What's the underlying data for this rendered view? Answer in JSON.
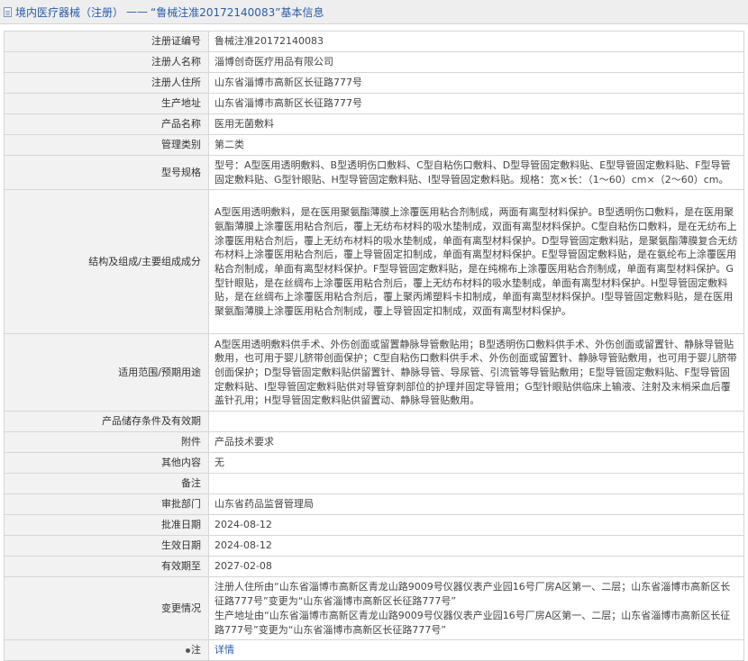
{
  "breadcrumb": {
    "section": "境内医疗器械（注册）",
    "separator": "——",
    "record_title": "“鲁械注准20172140083”",
    "suffix": "基本信息"
  },
  "fields": [
    {
      "key": "reg_no",
      "label": "注册证编号",
      "value": "鲁械注准20172140083"
    },
    {
      "key": "registrant",
      "label": "注册人名称",
      "value": "淄博创奇医疗用品有限公司"
    },
    {
      "key": "registrant_address",
      "label": "注册人住所",
      "value": "山东省淄博市高新区长征路777号"
    },
    {
      "key": "production_address",
      "label": "生产地址",
      "value": "山东省淄博市高新区长征路777号"
    },
    {
      "key": "product_name",
      "label": "产品名称",
      "value": "医用无菌敷料"
    },
    {
      "key": "management_class",
      "label": "管理类别",
      "value": "第二类"
    },
    {
      "key": "models",
      "label": "型号规格",
      "value": "型号：A型医用透明敷料、B型透明伤口敷料、C型自粘伤口敷料、D型导管固定敷料贴、E型导管固定敷料贴、F型导管固定敷料贴、G型针眼贴、H型导管固定敷料贴、I型导管固定敷料贴。规格：宽×长：（1～60）cm×（2～60）cm。"
    },
    {
      "key": "composition",
      "label": "结构及组成/主要组成成分",
      "value": "A型医用透明敷料，是在医用聚氨酯薄膜上涂覆医用粘合剂制成，两面有离型材料保护。B型透明伤口敷料，是在医用聚氨酯薄膜上涂覆医用粘合剂后，覆上无纺布材料的吸水垫制成，双面有离型材料保护。C型自粘伤口敷料，是在无纺布上涂覆医用粘合剂后，覆上无纺布材料的吸水垫制成，单面有离型材料保护。D型导管固定敷料贴，是聚氨酯薄膜复合无纺布材料上涂覆医用粘合剂后，覆上导管固定扣制成，单面有离型材料保护。E型导管固定敷料贴，是在氨纶布上涂覆医用粘合剂制成，单面有离型材料保护。F型导管固定敷料贴，是在纯棉布上涂覆医用粘合剂制成，单面有离型材料保护。G型针眼贴，是在丝绸布上涂覆医用粘合剂后，覆上无纺布材料的吸水垫制成，单面有离型材料保护。H型导管固定敷料贴，是在丝绸布上涂覆医用粘合剂后，覆上聚丙烯塑料卡扣制成，单面有离型材料保护。I型导管固定敷料贴，是在医用聚氨酯薄膜上涂覆医用粘合剂制成，覆上导管固定扣制成，双面有离型材料保护。"
    },
    {
      "key": "scope",
      "label": "适用范围/预期用途",
      "value": "A型医用透明敷料供手术、外伤创面或留置静脉导管敷贴用；B型透明伤口敷料供手术、外伤创面或留置针、静脉导管贴敷用，也可用于婴儿脐带创面保护；C型自粘伤口敷料供手术、外伤创面或留置针、静脉导管贴敷用，也可用于婴儿脐带创面保护；D型导管固定敷料贴供留置针、静脉导管、导尿管、引流管等导管贴敷用；E型导管固定敷料贴、F型导管固定敷料贴、I型导管固定敷料贴供对导管穿刺部位的护理并固定导管用；G型针眼贴供临床上输液、注射及末梢采血后覆盖针孔用；H型导管固定敷料贴供留置动、静脉导管贴敷用。"
    },
    {
      "key": "storage",
      "label": "产品储存条件及有效期",
      "value": ""
    },
    {
      "key": "attachment",
      "label": "附件",
      "value": "产品技术要求"
    },
    {
      "key": "other",
      "label": "其他内容",
      "value": "无"
    },
    {
      "key": "remarks",
      "label": "备注",
      "value": ""
    },
    {
      "key": "approval_dept",
      "label": "审批部门",
      "value": "山东省药品监督管理局"
    },
    {
      "key": "approval_date",
      "label": "批准日期",
      "value": "2024-08-12"
    },
    {
      "key": "effective_date",
      "label": "生效日期",
      "value": "2024-08-12"
    },
    {
      "key": "expiry_date",
      "label": "有效期至",
      "value": "2027-02-08"
    },
    {
      "key": "changes",
      "label": "变更情况",
      "value": "注册人住所由“山东省淄博市高新区青龙山路9009号仪器仪表产业园16号厂房A区第一、二层；山东省淄博市高新区长征路777号”变更为“山东省淄博市高新区长征路777号”\n生产地址由“山东省淄博市高新区青龙山路9009号仪器仪表产业园16号厂房A区第一、二层；山东省淄博市高新区长征路777号”变更为“山东省淄博市高新区长征路777号”"
    }
  ],
  "note_row": {
    "label": "注",
    "link_text": "详情",
    "icon": "bullet-icon"
  }
}
